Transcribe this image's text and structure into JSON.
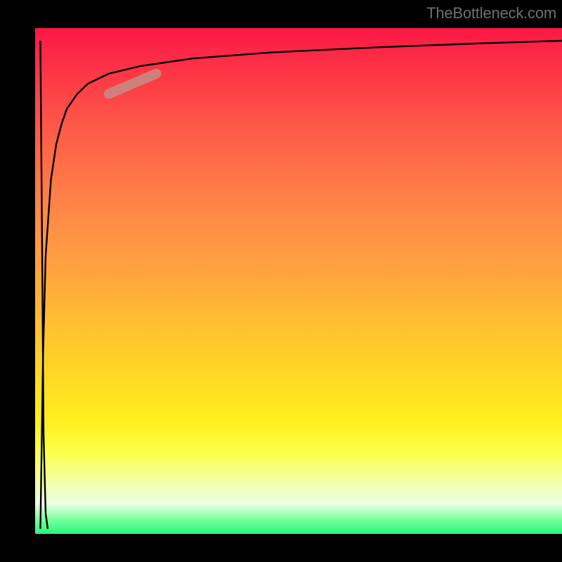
{
  "watermark": "TheBottleneck.com",
  "chart_data": {
    "type": "line",
    "title": "",
    "xlabel": "",
    "ylabel": "",
    "xlim": [
      0,
      100
    ],
    "ylim": [
      0,
      100
    ],
    "curve1": {
      "name": "rising-curve",
      "x": [
        1.0,
        1.5,
        2.0,
        3.0,
        4.0,
        5.0,
        6.0,
        8.0,
        10.0,
        14.0,
        20.0,
        30.0,
        45.0,
        65.0,
        85.0,
        100.0
      ],
      "y": [
        1.0,
        35.0,
        55.0,
        70.0,
        77.0,
        81.0,
        84.0,
        87.0,
        89.0,
        91.0,
        92.5,
        94.0,
        95.2,
        96.2,
        97.0,
        97.5
      ]
    },
    "curve2": {
      "name": "dip-curve",
      "x": [
        1.0,
        1.3,
        1.6,
        2.0,
        2.4
      ],
      "y": [
        97.5,
        60.0,
        20.0,
        4.0,
        1.0
      ]
    },
    "highlight_segment": {
      "x": [
        14.0,
        23.0
      ],
      "y": [
        87.0,
        91.0
      ]
    },
    "background_gradient_stops": [
      {
        "pos": 0.0,
        "color": "#fb1745"
      },
      {
        "pos": 1.0,
        "color": "#27f57d"
      }
    ]
  }
}
